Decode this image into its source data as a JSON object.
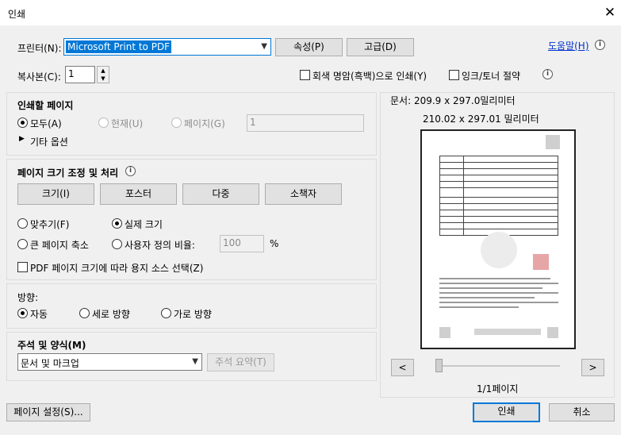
{
  "window": {
    "title": "인쇄"
  },
  "printer": {
    "label": "프린터(N):",
    "selected": "Microsoft Print to PDF",
    "properties_button": "속성(P)",
    "advanced_button": "고급(D)",
    "help_link": "도움말(H)"
  },
  "copies": {
    "label": "복사본(C):",
    "value": "1",
    "grayscale_label": "회색 명암(흑백)으로 인쇄(Y)",
    "ink_save_label": "잉크/토너 절약"
  },
  "pages_to_print": {
    "title": "인쇄할 페이지",
    "all_label": "모두(A)",
    "current_label": "현재(U)",
    "pages_label": "페이지(G)",
    "pages_value": "1",
    "more_options_label": "기타 옵션"
  },
  "page_sizing": {
    "title": "페이지 크기 조정 및 처리",
    "tabs": [
      "크기(I)",
      "포스터",
      "다중",
      "소책자"
    ],
    "fit_label": "맞추기(F)",
    "actual_size_label": "실제 크기",
    "shrink_label": "큰 페이지 축소",
    "custom_scale_label": "사용자 정의 비율:",
    "custom_scale_value": "100",
    "percent_sign": "%",
    "pdf_source_label": "PDF 페이지 크기에 따라 용지 소스 선택(Z)"
  },
  "orientation": {
    "title": "방향:",
    "auto_label": "자동",
    "portrait_label": "세로 방향",
    "landscape_label": "가로 방향"
  },
  "comments": {
    "title": "주석 및 양식(M)",
    "selected": "문서 및 마크업",
    "summary_button": "주석 요약(T)"
  },
  "preview": {
    "document_size": "문서: 209.9 x 297.0밀리미터",
    "paper_size": "210.02 x 297.01 밀리미터",
    "prev_button": "<",
    "next_button": ">",
    "page_indicator": "1/1페이지"
  },
  "footer": {
    "page_setup_button": "페이지 설정(S)...",
    "print_button": "인쇄",
    "cancel_button": "취소"
  }
}
